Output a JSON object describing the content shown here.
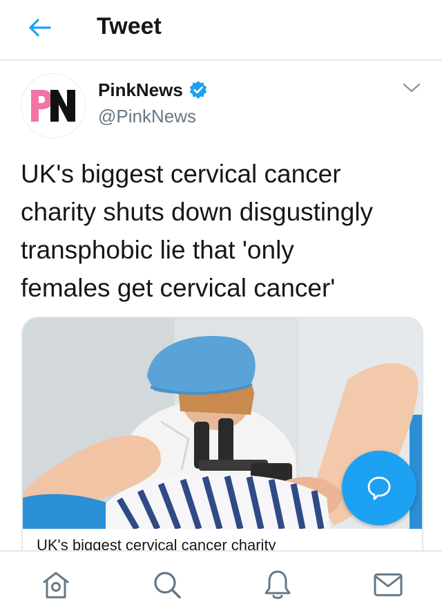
{
  "header": {
    "title": "Tweet",
    "back_icon": "arrow-left-icon"
  },
  "author": {
    "display_name": "PinkNews",
    "handle": "@PinkNews",
    "verified": true,
    "avatar_logo": "PN",
    "avatar_colors": [
      "#f274a7",
      "#111111"
    ]
  },
  "tweet": {
    "text": "UK's biggest cervical cancer\ncharity shuts down disgustingly\ntransphobic lie that 'only\nfemales get cervical cancer'"
  },
  "card": {
    "title": "UK's biggest cervical cancer charity"
  },
  "fab": {
    "icon": "reply-bubble-icon"
  },
  "bottom_nav": [
    {
      "name": "home",
      "icon": "home-icon"
    },
    {
      "name": "search",
      "icon": "search-icon"
    },
    {
      "name": "notifications",
      "icon": "bell-icon"
    },
    {
      "name": "messages",
      "icon": "envelope-icon"
    }
  ],
  "colors": {
    "accent": "#1da1f2",
    "text": "#14171a",
    "secondary_text": "#657786",
    "nav_icon": "#657786"
  }
}
